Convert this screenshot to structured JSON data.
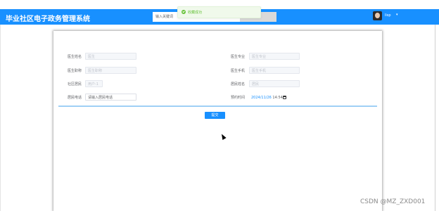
{
  "header": {
    "title": "毕业社区电子政务管理系统",
    "search_placeholder": "输入关键词",
    "username": "lisp",
    "caret": "▾"
  },
  "toast": {
    "message": "收藏成功"
  },
  "form": {
    "doctor_name": {
      "label": "医生姓名",
      "value": "医生"
    },
    "doctor_major": {
      "label": "医生专业",
      "value": "医生专业"
    },
    "doctor_title": {
      "label": "医生职称",
      "value": "医生职称"
    },
    "doctor_phone": {
      "label": "医生手机",
      "value": "医生手机"
    },
    "community": {
      "label": "社区居民",
      "value": "用户-1"
    },
    "resident_name": {
      "label": "居民姓名",
      "value": "居民"
    },
    "resident_phone": {
      "label": "居民电话",
      "placeholder": "请输入居民电话"
    },
    "appointment_time": {
      "label": "预约时间",
      "date": "2024/11/26",
      "time": "14:54"
    },
    "submit_label": "提交"
  },
  "watermark": "CSDN @MZ_ZXD001"
}
